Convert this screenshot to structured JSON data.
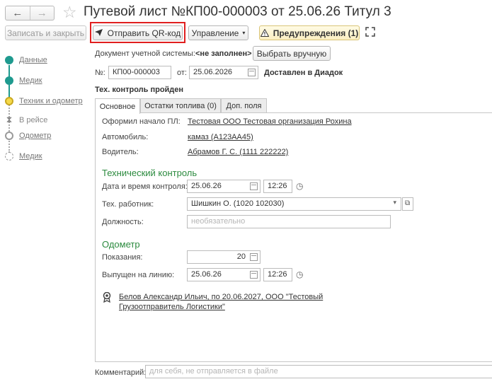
{
  "title": "Путевой лист №КП00-000003 от 25.06.26 Титул 3",
  "nav": {
    "back": "←",
    "forward": "→"
  },
  "toolbar": {
    "save_close": "Записать и закрыть",
    "send_qr": "Отправить QR-код",
    "manage": "Управление",
    "warnings": "Предупреждения (1)"
  },
  "steps": [
    {
      "label": "Данные"
    },
    {
      "label": "Медик"
    },
    {
      "label": "Техник и одометр"
    },
    {
      "label": "В рейсе"
    },
    {
      "label": "Одометр"
    },
    {
      "label": "Медик"
    }
  ],
  "doc": {
    "account_label": "Документ учетной системы:",
    "account_value": "<не заполнен>",
    "choose_manual": "Выбрать вручную",
    "number_label": "№:",
    "number_value": "КП00-000003",
    "from_label": "от:",
    "date_value": "25.06.2026",
    "delivered": "Доставлен в Диадок",
    "tech_status": "Тех. контроль пройден"
  },
  "tabs": [
    "Основное",
    "Остатки топлива (0)",
    "Доп. поля"
  ],
  "main": {
    "issued_label": "Оформил начало ПЛ:",
    "issued_value": "Тестовая ООО Тестовая организация Рохина",
    "car_label": "Автомобиль:",
    "car_value": "камаз (А123АА45)",
    "driver_label": "Водитель:",
    "driver_value": "Абрамов Г. С. (1111 222222)",
    "tech_section": "Технический контроль",
    "control_dt_label": "Дата и время контроля:",
    "control_date": "25.06.26",
    "control_time": "12:26",
    "worker_label": "Тех. работник:",
    "worker_value": "Шишкин О. (1020 102030)",
    "position_label": "Должность:",
    "position_placeholder": "необязательно",
    "odo_section": "Одометр",
    "reading_label": "Показания:",
    "reading_value": "20",
    "released_label": "Выпущен на линию:",
    "released_date": "25.06.26",
    "released_time": "12:26",
    "signer_line1": "Белов Александр Ильич, по 20.06.2027, ООО \"Тестовый",
    "signer_line2": "Грузоотправитель Логистики\""
  },
  "comment": {
    "label": "Комментарий:",
    "placeholder": "для себя, не отправляется в файле"
  }
}
